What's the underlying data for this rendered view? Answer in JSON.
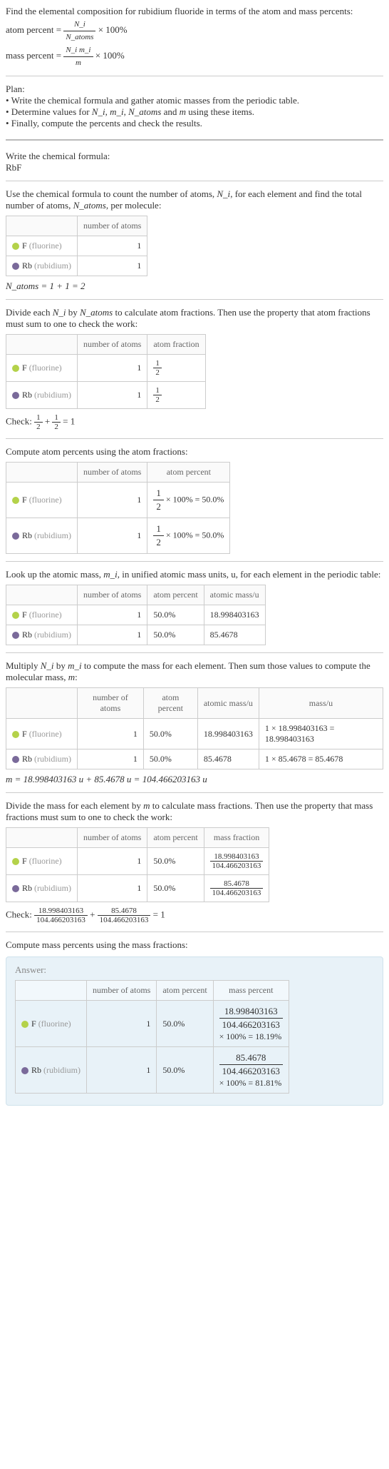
{
  "intro": {
    "title": "Find the elemental composition for rubidium fluoride in terms of the atom and mass percents:",
    "eq1_lhs": "atom percent = ",
    "eq1_num": "N_i",
    "eq1_den": "N_atoms",
    "eq1_rhs": " × 100%",
    "eq2_lhs": "mass percent = ",
    "eq2_num": "N_i m_i",
    "eq2_den": "m",
    "eq2_rhs": " × 100%"
  },
  "plan": {
    "heading": "Plan:",
    "b1": "• Write the chemical formula and gather atomic masses from the periodic table.",
    "b2_a": "• Determine values for ",
    "b2_b": "N_i, m_i, N_atoms",
    "b2_c": " and ",
    "b2_d": "m",
    "b2_e": " using these items.",
    "b3": "• Finally, compute the percents and check the results."
  },
  "stepFormula": {
    "line1": "Write the chemical formula:",
    "formula": "RbF"
  },
  "stepCount": {
    "intro_a": "Use the chemical formula to count the number of atoms, ",
    "intro_b": "N_i",
    "intro_c": ", for each element and find the total number of atoms, ",
    "intro_d": "N_atoms",
    "intro_e": ", per molecule:",
    "hdr_atoms": "number of atoms",
    "Natoms_eq": "N_atoms = 1 + 1 = 2"
  },
  "elements": {
    "F": {
      "symbol": "F",
      "paren": "(fluorine)",
      "n": "1",
      "mass": "18.998403163"
    },
    "Rb": {
      "symbol": "Rb",
      "paren": "(rubidium)",
      "n": "1",
      "mass": "85.4678"
    }
  },
  "stepAtomFrac": {
    "intro_a": "Divide each ",
    "intro_b": "N_i",
    "intro_c": " by ",
    "intro_d": "N_atoms",
    "intro_e": " to calculate atom fractions. Then use the property that atom fractions must sum to one to check the work:",
    "hdr_atoms": "number of atoms",
    "hdr_frac": "atom fraction",
    "frac_num": "1",
    "frac_den": "2",
    "check_a": "Check: ",
    "check_mid": " + ",
    "check_eq": " = 1"
  },
  "stepAtomPct": {
    "intro": "Compute atom percents using the atom fractions:",
    "hdr_atoms": "number of atoms",
    "hdr_pct": "atom percent",
    "pct_suffix": " × 100% = 50.0%",
    "pct_short": "50.0%"
  },
  "stepMassLookup": {
    "intro_a": "Look up the atomic mass, ",
    "intro_b": "m_i",
    "intro_c": ", in unified atomic mass units, u, for each element in the periodic table:",
    "hdr_atoms": "number of atoms",
    "hdr_pct": "atom percent",
    "hdr_mass": "atomic mass/u"
  },
  "stepMassCompute": {
    "intro_a": "Multiply ",
    "intro_b": "N_i",
    "intro_c": " by ",
    "intro_d": "m_i",
    "intro_e": " to compute the mass for each element. Then sum those values to compute the molecular mass, ",
    "intro_f": "m",
    "intro_g": ":",
    "hdr_atoms": "number of atoms",
    "hdr_pct": "atom percent",
    "hdr_mass": "atomic mass/u",
    "hdr_massu": "mass/u",
    "F_massu": "1 × 18.998403163 = 18.998403163",
    "Rb_massu": "1 × 85.4678 = 85.4678",
    "m_eq": "m = 18.998403163 u + 85.4678 u = 104.466203163 u"
  },
  "stepMassFrac": {
    "intro_a": "Divide the mass for each element by ",
    "intro_b": "m",
    "intro_c": " to calculate mass fractions. Then use the property that mass fractions must sum to one to check the work:",
    "hdr_atoms": "number of atoms",
    "hdr_pct": "atom percent",
    "hdr_mf": "mass fraction",
    "F_num": "18.998403163",
    "Rb_num": "85.4678",
    "den": "104.466203163",
    "check_a": "Check: ",
    "check_plus": " + ",
    "check_eq": " = 1"
  },
  "stepMassPct": {
    "intro": "Compute mass percents using the mass fractions:"
  },
  "answer": {
    "label": "Answer:",
    "hdr_atoms": "number of atoms",
    "hdr_pct": "atom percent",
    "hdr_mp": "mass percent",
    "F_num": "18.998403163",
    "Rb_num": "85.4678",
    "den": "104.466203163",
    "F_suffix": " × 100% = 18.19%",
    "Rb_suffix": " × 100% = 81.81%"
  }
}
